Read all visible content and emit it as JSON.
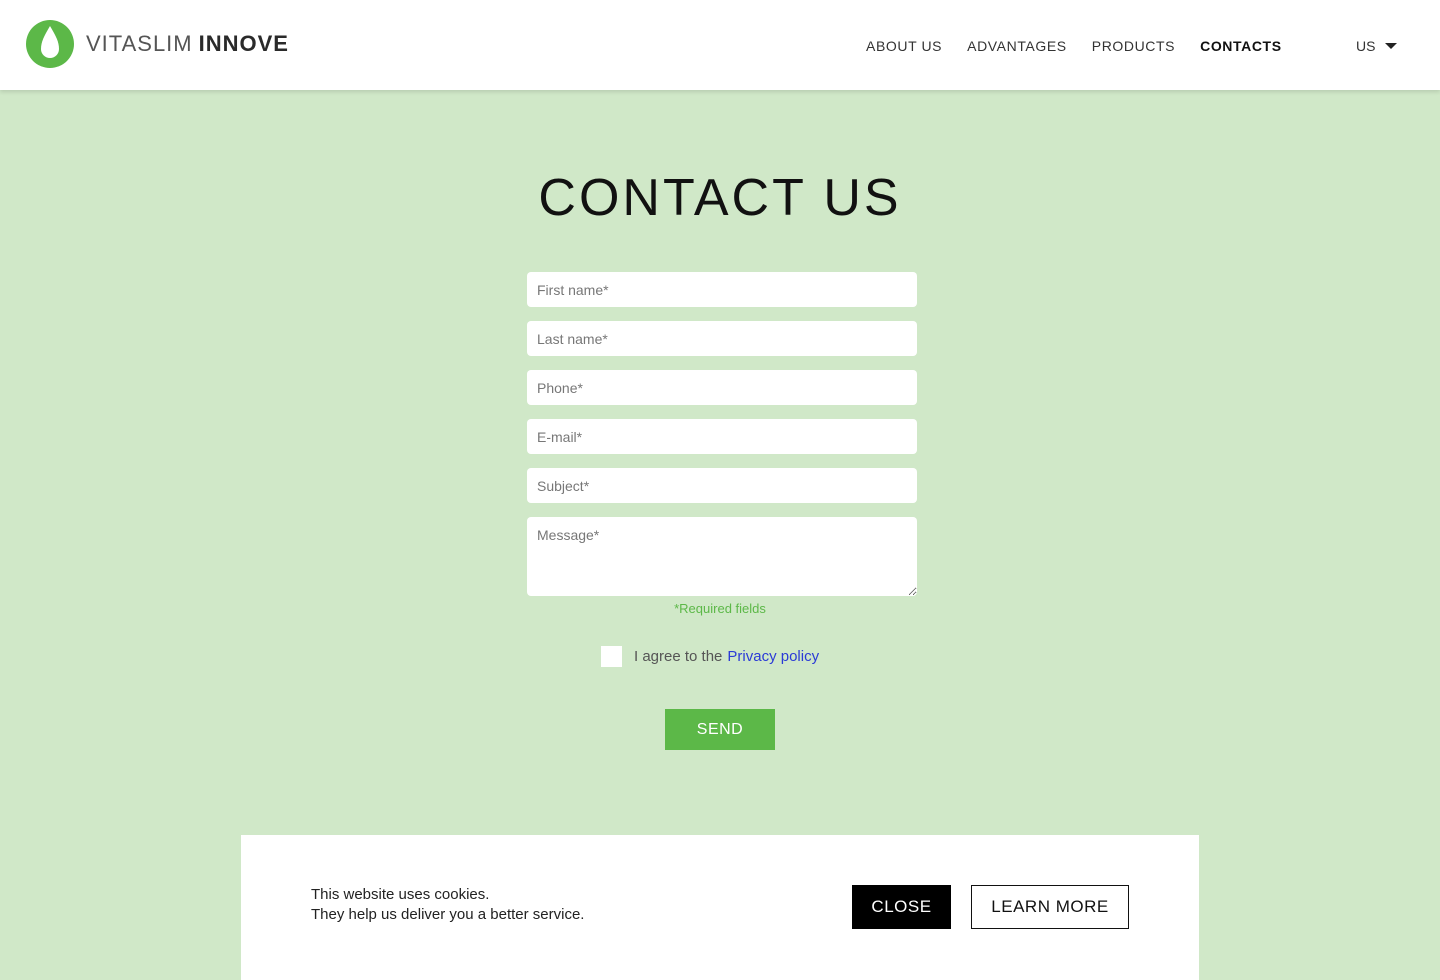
{
  "brand": {
    "name_light": "VITASLIM",
    "name_bold": "INNOVE",
    "logo_icon": "leaf-drop-icon",
    "accent_color": "#5cb848"
  },
  "nav": {
    "items": [
      {
        "label": "ABOUT US"
      },
      {
        "label": "ADVANTAGES"
      },
      {
        "label": "PRODUCTS"
      },
      {
        "label": "CONTACTS",
        "active": true
      }
    ],
    "language": "US"
  },
  "page": {
    "title": "CONTACT US"
  },
  "form": {
    "first_name_placeholder": "First name*",
    "last_name_placeholder": "Last name*",
    "phone_placeholder": "Phone*",
    "email_placeholder": "E-mail*",
    "subject_placeholder": "Subject*",
    "message_placeholder": "Message*",
    "required_note": "*Required fields",
    "agree_text": "I agree to the",
    "privacy_link": "Privacy policy",
    "send_label": "SEND"
  },
  "cookie": {
    "line1": "This website uses cookies.",
    "line2": "They help us deliver you a better service.",
    "close_label": "CLOSE",
    "learn_more_label": "LEARN MORE"
  }
}
